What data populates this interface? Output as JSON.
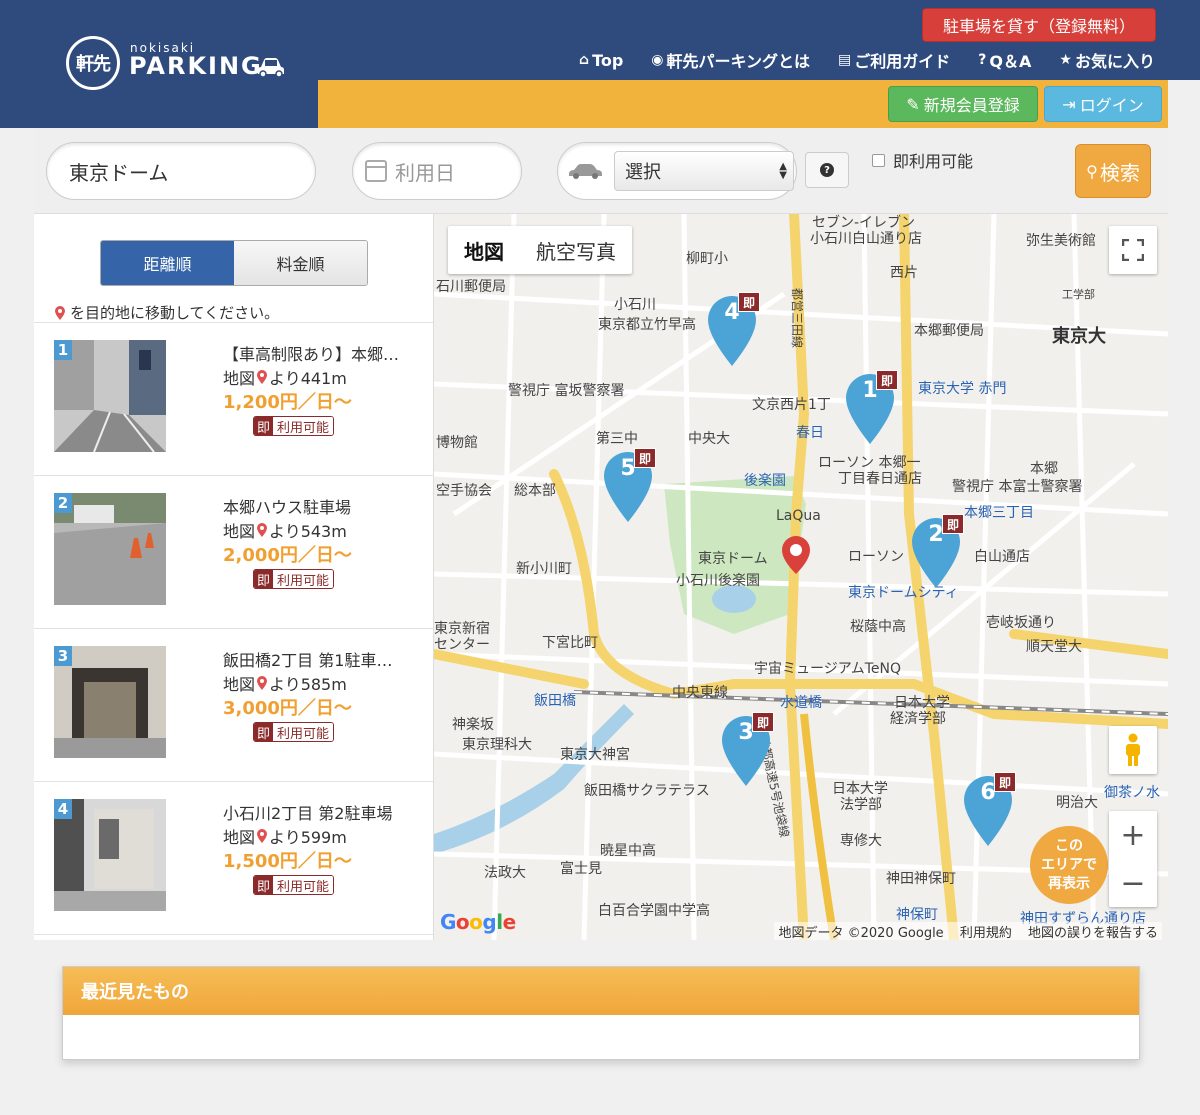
{
  "header": {
    "logo_kanji": "軒先",
    "logo_sub": "nokisaki",
    "logo_main": "PARKING",
    "lend_button": "駐車場を貸す（登録無料）",
    "nav": [
      {
        "icon": "⌂",
        "label": "Top"
      },
      {
        "icon": "◉",
        "label": "軒先パーキングとは"
      },
      {
        "icon": "▤",
        "label": "ご利用ガイド"
      },
      {
        "icon": "?",
        "label": "Q＆A"
      },
      {
        "icon": "★",
        "label": "お気に入り"
      }
    ],
    "register_button": "新規会員登録",
    "login_button": "ログイン",
    "colors": {
      "navy": "#2f4a7c",
      "yellow": "#f2b33c",
      "red": "#d7403a",
      "green": "#5cb85c",
      "blue": "#5bb8de"
    }
  },
  "search": {
    "place_value": "東京ドーム",
    "date_placeholder": "利用日",
    "car_select_value": "選択",
    "instant_label": "即利用可能",
    "search_button": "検索"
  },
  "list": {
    "sort_tabs": [
      "距離順",
      "料金順"
    ],
    "hint": "を目的地に移動してください。",
    "items": [
      {
        "num": "1",
        "title": "【車高制限あり】本郷…",
        "dist_prefix": "地図",
        "dist": "より441m",
        "price": "1,200円／日〜",
        "badge_soku": "即",
        "badge_text": "利用可能"
      },
      {
        "num": "2",
        "title": "本郷ハウス駐車場",
        "dist_prefix": "地図",
        "dist": "より543m",
        "price": "2,000円／日〜",
        "badge_soku": "即",
        "badge_text": "利用可能"
      },
      {
        "num": "3",
        "title": "飯田橋2丁目 第1駐車…",
        "dist_prefix": "地図",
        "dist": "より585m",
        "price": "3,000円／日〜",
        "badge_soku": "即",
        "badge_text": "利用可能"
      },
      {
        "num": "4",
        "title": "小石川2丁目 第2駐車場",
        "dist_prefix": "地図",
        "dist": "より599m",
        "price": "1,500円／日〜",
        "badge_soku": "即",
        "badge_text": "利用可能"
      }
    ]
  },
  "map": {
    "type_buttons": [
      "地図",
      "航空写真"
    ],
    "redisplay": [
      "この",
      "エリアで",
      "再表示"
    ],
    "google": "Google",
    "attribution": [
      "地図データ ©2020 Google",
      "利用規約",
      "地図の誤りを報告する"
    ],
    "marker_soku": "即",
    "markers": [
      "1",
      "2",
      "3",
      "4",
      "5",
      "6"
    ],
    "labels": {
      "l1": "東京大",
      "l2": "東京ドーム",
      "l3": "小石川後楽園",
      "l4": "宇宙ミュージアムTeNQ",
      "l5": "飯田橋",
      "l6": "水道橋",
      "l7": "日本大学",
      "l8": "経済学部",
      "l9": "春日",
      "l10": "後楽園",
      "l11": "LaQua",
      "l12": "東京ドームシティ",
      "l13": "警視庁 富坂警察署",
      "l14": "東京大学 赤門",
      "l15": "本郷郵便局",
      "l16": "順天堂大",
      "l17": "桜蔭中高",
      "l18": "中央東線",
      "l19": "東京大神宮",
      "l20": "飯田橋サクラテラス",
      "l21": "暁星中高",
      "l22": "白百合学園中学高",
      "l23": "法政大",
      "l24": "専修大",
      "l25": "神保町",
      "l26": "明治大",
      "l27": "御茶ノ水",
      "l28": "本郷三丁目",
      "l29": "文京西片1丁",
      "l30": "東京理科大",
      "l31": "柳町小",
      "l32": "東京都立竹早高",
      "l33": "第三中",
      "l34": "中央大",
      "l35": "総本部",
      "l36": "弥生美術館",
      "l37": "セブン-イレブン",
      "l38": "小石川白山通り店",
      "l39": "ローソン 本郷一",
      "l40": "丁目春日通店",
      "l41": "日本大学",
      "l42": "法学部",
      "l43": "警視庁 本富士警察署",
      "l44": "新小川町",
      "l45": "下宮比町",
      "l46": "神楽坂",
      "l47": "ローソン",
      "l48": "白山通店",
      "l49": "壱岐坂通り",
      "l50": "西片",
      "l51": "工学部",
      "l52": "東京新宿",
      "l53": "センター",
      "l54": "首都高速5号池袋線",
      "l55": "神田神保町",
      "l56": "富士見",
      "l57": "博物館",
      "l58": "空手協会",
      "l59": "石川郵便局",
      "l60": "小石川",
      "l61": "本郷",
      "l62": "都営三田線",
      "l63": "神田すずらん通り店"
    }
  },
  "recent": {
    "title": "最近見たもの"
  }
}
